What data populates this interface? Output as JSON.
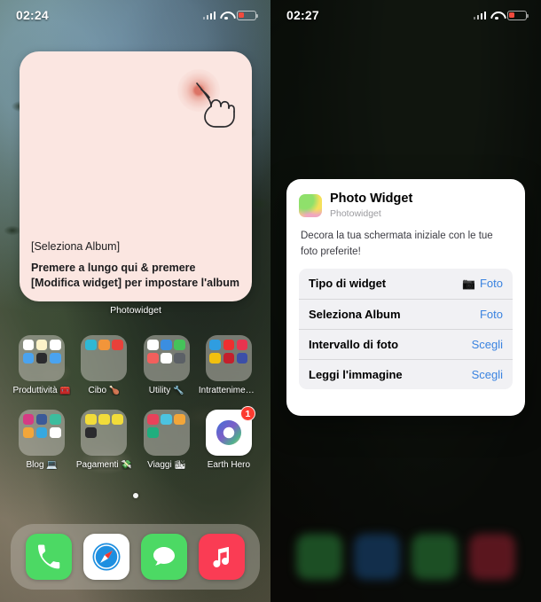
{
  "left_screen": {
    "status_bar": {
      "time": "02:24",
      "wifi_icon": "wifi-icon",
      "signal_icon": "cellular-signal-icon",
      "battery_icon": "battery-low-icon"
    },
    "widget": {
      "album_placeholder": "[Seleziona Album]",
      "hint": "Premere a lungo qui &  premere [Modifica widget] per impostare l'album",
      "label": "Photowidget",
      "gesture_icon": "tap-hand-icon",
      "background_color": "#fbe6e1"
    },
    "apps": [
      {
        "name": "Produttività 🧰",
        "type": "folder",
        "tiles": [
          "#ffffff",
          "#fdf3c8",
          "#ffffff",
          "#4aa3ef",
          "#2b2b2e",
          "#4aa3ef",
          "",
          "",
          ""
        ]
      },
      {
        "name": "Cibo 🍗",
        "type": "folder",
        "tiles": [
          "#2fb8d4",
          "#f2953a",
          "#e8413a",
          "",
          "",
          "",
          "",
          "",
          ""
        ]
      },
      {
        "name": "Utility 🔧",
        "type": "folder",
        "tiles": [
          "#ffffff",
          "#3b8ee0",
          "#45c25a",
          "#f25f5c",
          "#ffffff",
          "#5b6066",
          "",
          "",
          ""
        ]
      },
      {
        "name": "Intrattenimento...",
        "type": "folder",
        "tiles": [
          "#2f9de0",
          "#ee2f2f",
          "#e8344f",
          "#f2c00f",
          "#c4202c",
          "#3b4fa8",
          "",
          "",
          ""
        ]
      },
      {
        "name": "Blog 💻",
        "type": "folder",
        "tiles": [
          "#d63a84",
          "#3b5998",
          "#3dbd9e",
          "#f2a63a",
          "#36a8e0",
          "#ffffff",
          "",
          "",
          ""
        ]
      },
      {
        "name": "Pagamenti 💸",
        "type": "folder",
        "tiles": [
          "#f2dc3a",
          "#f2dc3a",
          "#f2dc3a",
          "#2b2b2e",
          "",
          "",
          "",
          "",
          ""
        ]
      },
      {
        "name": "Viaggi 🏙",
        "type": "folder",
        "tiles": [
          "#e8425a",
          "#4cc3e0",
          "#f2a63a",
          "#1fae7e",
          "",
          "",
          "",
          "",
          ""
        ]
      },
      {
        "name": "Earth Hero",
        "type": "app",
        "badge": "1"
      }
    ],
    "page_dots": 1,
    "dock": [
      {
        "name": "Phone",
        "color": "#4cd964"
      },
      {
        "name": "Safari",
        "color": "#ffffff"
      },
      {
        "name": "Messages",
        "color": "#4cd964"
      },
      {
        "name": "Music",
        "color": "#fa3c54"
      }
    ]
  },
  "right_screen": {
    "status_bar": {
      "time": "02:27",
      "wifi_icon": "wifi-icon",
      "signal_icon": "cellular-signal-icon",
      "battery_icon": "battery-low-icon"
    },
    "panel": {
      "app_title": "Photo Widget",
      "app_subtitle": "Photowidget",
      "description": "Decora la tua schermata iniziale con le tue foto preferite!",
      "rows": [
        {
          "label": "Tipo di widget",
          "value": "Foto",
          "icon": "camera-icon"
        },
        {
          "label": "Seleziona Album",
          "value": "Foto",
          "icon": ""
        },
        {
          "label": "Intervallo di foto",
          "value": "Scegli",
          "icon": ""
        },
        {
          "label": "Leggi l'immagine",
          "value": "Scegli",
          "icon": ""
        }
      ],
      "accent_color": "#3a83e0"
    }
  }
}
